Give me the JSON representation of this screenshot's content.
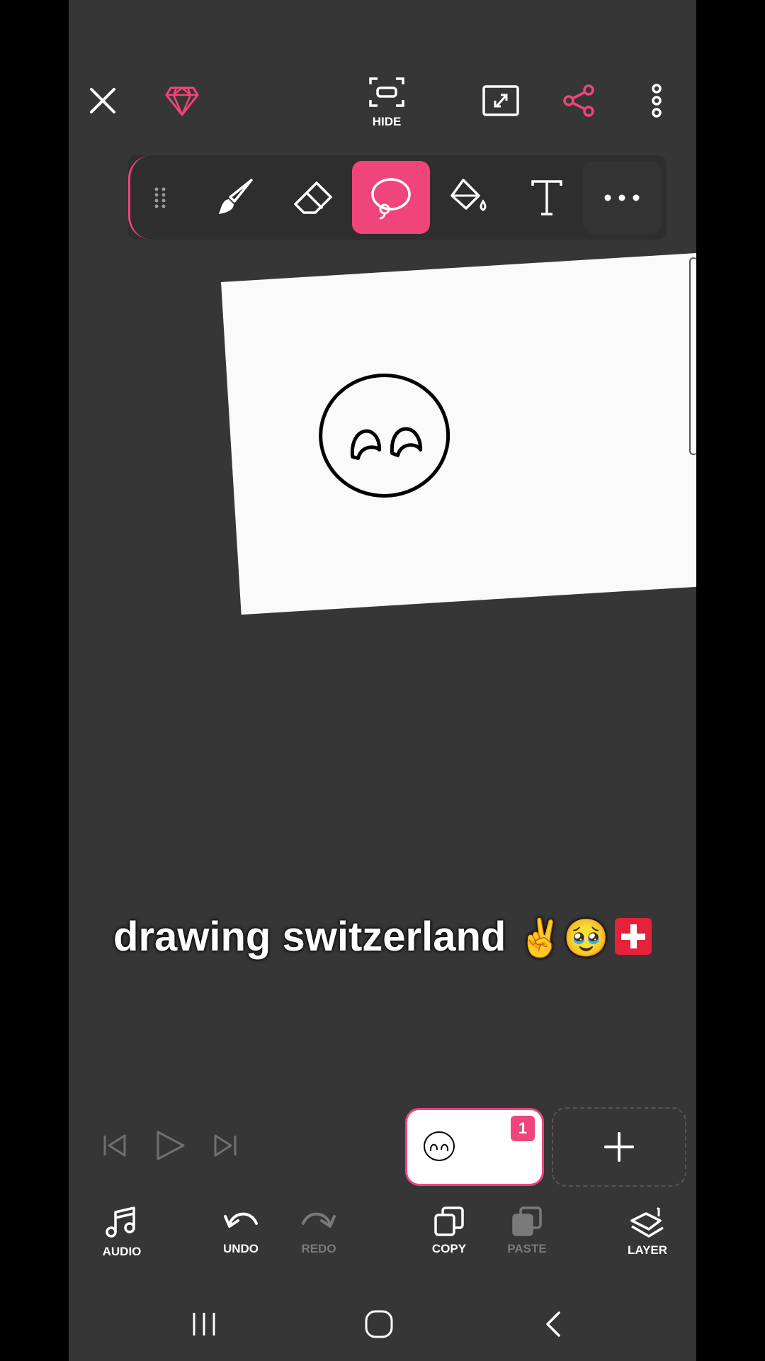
{
  "top_bar": {
    "hide_label": "HIDE",
    "icons": [
      "close-icon",
      "gem-icon",
      "hide-frame-icon",
      "fullscreen-icon",
      "share-icon",
      "more-vertical-icon"
    ]
  },
  "toolbar": {
    "tools": [
      "drag-handle-icon",
      "brush-icon",
      "eraser-icon",
      "lasso-icon",
      "fill-bucket-icon",
      "text-icon",
      "more-horizontal-icon"
    ],
    "active_tool": "lasso",
    "accent_color": "#f0457a"
  },
  "caption": {
    "text": "drawing switzerland",
    "emoji": "✌️🥹"
  },
  "frames": {
    "badge": "1"
  },
  "bottom_bar": {
    "audio": "AUDIO",
    "undo": "UNDO",
    "redo": "REDO",
    "copy": "COPY",
    "paste": "PASTE",
    "layer": "LAYER"
  }
}
